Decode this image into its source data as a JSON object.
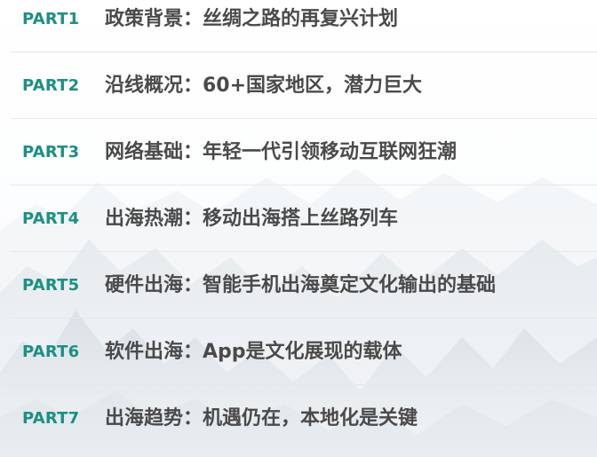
{
  "toc": {
    "items": [
      {
        "part": "PART1",
        "title": "政策背景：丝绸之路的再复兴计划"
      },
      {
        "part": "PART2",
        "title": "沿线概况：60+国家地区，潜力巨大"
      },
      {
        "part": "PART3",
        "title": "网络基础：年轻一代引领移动互联网狂潮"
      },
      {
        "part": "PART4",
        "title": "出海热潮：移动出海搭上丝路列车"
      },
      {
        "part": "PART5",
        "title": "硬件出海：智能手机出海奠定文化输出的基础"
      },
      {
        "part": "PART6",
        "title": "软件出海：App是文化展现的载体"
      },
      {
        "part": "PART7",
        "title": "出海趋势：机遇仍在，本地化是关键"
      }
    ]
  },
  "colors": {
    "part_label": "#1d8f83",
    "title_text": "#4a4a4a",
    "divider": "#e7e7e7"
  },
  "background": {
    "icon": "misty-mountains-illustration"
  }
}
